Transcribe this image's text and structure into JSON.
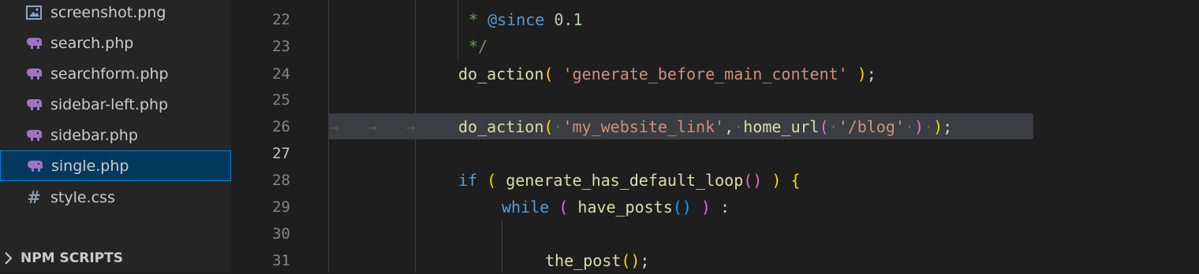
{
  "explorer": {
    "files": [
      {
        "name": "screenshot.png",
        "icon": "image-icon"
      },
      {
        "name": "search.php",
        "icon": "php-icon"
      },
      {
        "name": "searchform.php",
        "icon": "php-icon"
      },
      {
        "name": "sidebar-left.php",
        "icon": "php-icon"
      },
      {
        "name": "sidebar.php",
        "icon": "php-icon"
      },
      {
        "name": "single.php",
        "icon": "php-icon",
        "selected": true
      },
      {
        "name": "style.css",
        "icon": "css-hash-icon"
      }
    ],
    "npm_section": {
      "label": "NPM SCRIPTS",
      "icon": "chevron-right-icon"
    }
  },
  "editor": {
    "active_line": "27",
    "lines": [
      {
        "number": "22"
      },
      {
        "number": "23"
      },
      {
        "number": "24"
      },
      {
        "number": "25"
      },
      {
        "number": "26"
      },
      {
        "number": "27"
      },
      {
        "number": "28"
      },
      {
        "number": "29"
      },
      {
        "number": "30"
      },
      {
        "number": "31"
      }
    ],
    "tokens": {
      "l22": [
        "*",
        " @since",
        " 0.1"
      ],
      "l23": [
        "*/"
      ],
      "l24": [
        "do_action",
        "(",
        " 'generate_before_main_content'",
        " )",
        ";"
      ],
      "l26": [
        "do_action",
        "(",
        "·",
        "'my_website_link'",
        ",",
        "·",
        "home_url",
        "(",
        "·",
        "'/blog'",
        "·",
        ")",
        "·",
        ")",
        ";"
      ],
      "l28": [
        "if",
        " ",
        "(",
        " generate_has_default_loop",
        "()",
        " ",
        ")",
        " ",
        "{"
      ],
      "l29": [
        "while",
        " ",
        "(",
        " have_posts",
        "()",
        " ",
        ")",
        " :"
      ],
      "l31": [
        "the_post",
        "()",
        ";"
      ]
    }
  },
  "colors": {
    "sidebar_bg": "#252526",
    "editor_bg": "#1e1e1e",
    "selection_bg": "#04395e",
    "selection_border": "#007fd4",
    "php_icon": "#a074c4",
    "string": "#ce9178",
    "function": "#dcdcaa",
    "keyword": "#c586c0",
    "comment": "#6a9955"
  }
}
